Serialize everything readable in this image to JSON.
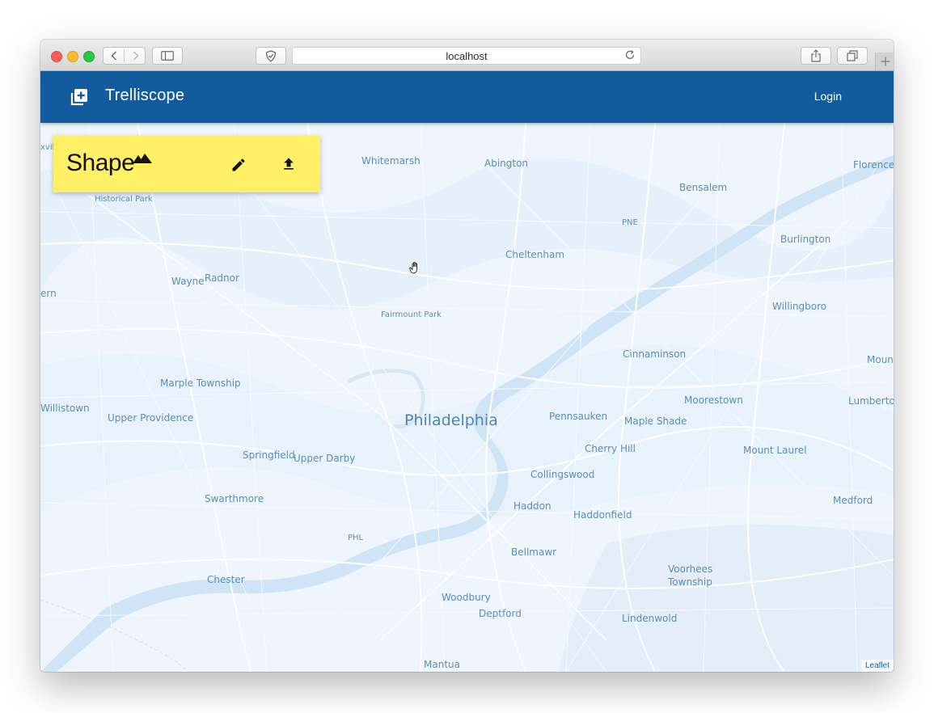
{
  "browser": {
    "url": "localhost"
  },
  "app": {
    "title": "Trelliscope",
    "login_label": "Login"
  },
  "shape_card": {
    "logo_text": "Shape"
  },
  "map": {
    "attribution": "Leaflet",
    "places": [
      {
        "id": "whitemarsh",
        "label": "Whitemarsh"
      },
      {
        "id": "abington",
        "label": "Abington"
      },
      {
        "id": "florence",
        "label": "Florence"
      },
      {
        "id": "bensalem",
        "label": "Bensalem"
      },
      {
        "id": "pne",
        "label": "PNE"
      },
      {
        "id": "burlington",
        "label": "Burlington"
      },
      {
        "id": "cheltenham",
        "label": "Cheltenham"
      },
      {
        "id": "wayne",
        "label": "Wayne"
      },
      {
        "id": "radnor",
        "label": "Radnor"
      },
      {
        "id": "willingboro",
        "label": "Willingboro"
      },
      {
        "id": "fairmount-park",
        "label": "Fairmount Park"
      },
      {
        "id": "historical-park",
        "label": "Historical Park"
      },
      {
        "id": "cinnaminson",
        "label": "Cinnaminson"
      },
      {
        "id": "mount",
        "label": "Mount"
      },
      {
        "id": "marple-township",
        "label": "Marple Township"
      },
      {
        "id": "moorestown",
        "label": "Moorestown"
      },
      {
        "id": "lumberton",
        "label": "Lumberton"
      },
      {
        "id": "willistown",
        "label": "Willistown"
      },
      {
        "id": "upper-providence",
        "label": "Upper Providence"
      },
      {
        "id": "philadelphia",
        "label": "Philadelphia"
      },
      {
        "id": "pennsauken",
        "label": "Pennsauken"
      },
      {
        "id": "maple-shade",
        "label": "Maple Shade"
      },
      {
        "id": "cherry-hill",
        "label": "Cherry Hill"
      },
      {
        "id": "mount-laurel",
        "label": "Mount Laurel"
      },
      {
        "id": "springfield",
        "label": "Springfield"
      },
      {
        "id": "upper-darby",
        "label": "Upper Darby"
      },
      {
        "id": "collingswood",
        "label": "Collingswood"
      },
      {
        "id": "swarthmore",
        "label": "Swarthmore"
      },
      {
        "id": "medford",
        "label": "Medford"
      },
      {
        "id": "haddon",
        "label": "Haddon"
      },
      {
        "id": "haddonfield",
        "label": "Haddonfield"
      },
      {
        "id": "phl",
        "label": "PHL"
      },
      {
        "id": "bellmawr",
        "label": "Bellmawr"
      },
      {
        "id": "voorhees",
        "label": "Voorhees"
      },
      {
        "id": "township",
        "label": "Township"
      },
      {
        "id": "chester",
        "label": "Chester"
      },
      {
        "id": "woodbury",
        "label": "Woodbury"
      },
      {
        "id": "deptford",
        "label": "Deptford"
      },
      {
        "id": "lindenwold",
        "label": "Lindenwold"
      },
      {
        "id": "mantua",
        "label": "Mantua"
      },
      {
        "id": "ern",
        "label": "ern"
      },
      {
        "id": "xvil",
        "label": "xvil"
      }
    ]
  }
}
